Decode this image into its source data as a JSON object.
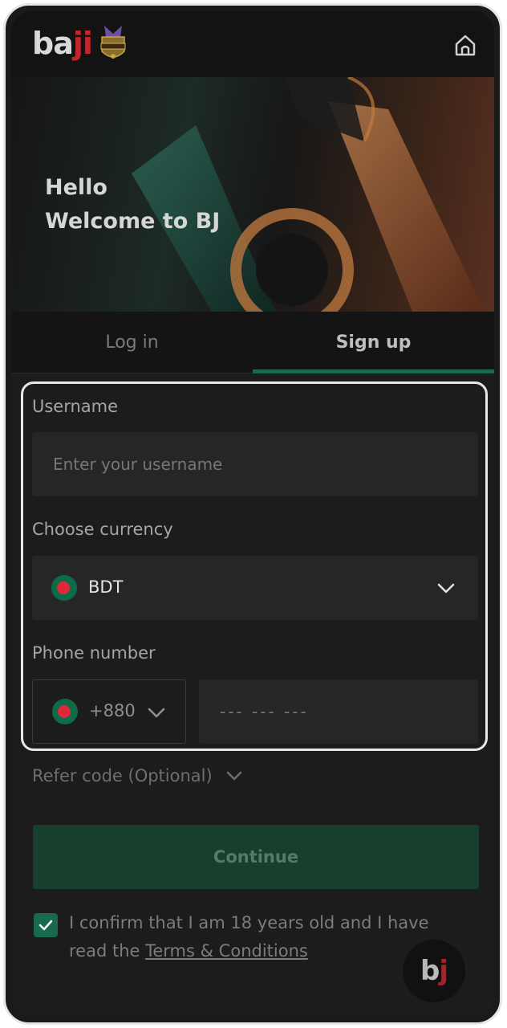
{
  "header": {
    "logo_main": "ba",
    "logo_accent": "ji"
  },
  "hero": {
    "hello": "Hello",
    "welcome": "Welcome to BJ"
  },
  "tabs": {
    "login": "Log in",
    "signup": "Sign up",
    "active": "signup"
  },
  "form": {
    "username_label": "Username",
    "username_placeholder": "Enter your username",
    "currency_label": "Choose currency",
    "currency_value": "BDT",
    "phone_label": "Phone number",
    "phone_code": "+880",
    "phone_placeholder": "--- --- ---",
    "refer_label": "Refer code (Optional)"
  },
  "actions": {
    "continue_label": "Continue"
  },
  "terms": {
    "confirm_text": "I confirm that I am 18 years old and I have read the ",
    "link_text": "Terms & Conditions",
    "checked": true
  },
  "floating_logo": {
    "b": "b",
    "j": "j"
  },
  "colors": {
    "accent_green": "#186a4d",
    "brand_red": "#c2272d",
    "background": "#1c1c1c"
  },
  "icons": {
    "home": "home-icon",
    "chevron": "chevron-down-icon",
    "check": "check-icon",
    "flag": "bangladesh-flag-icon"
  }
}
